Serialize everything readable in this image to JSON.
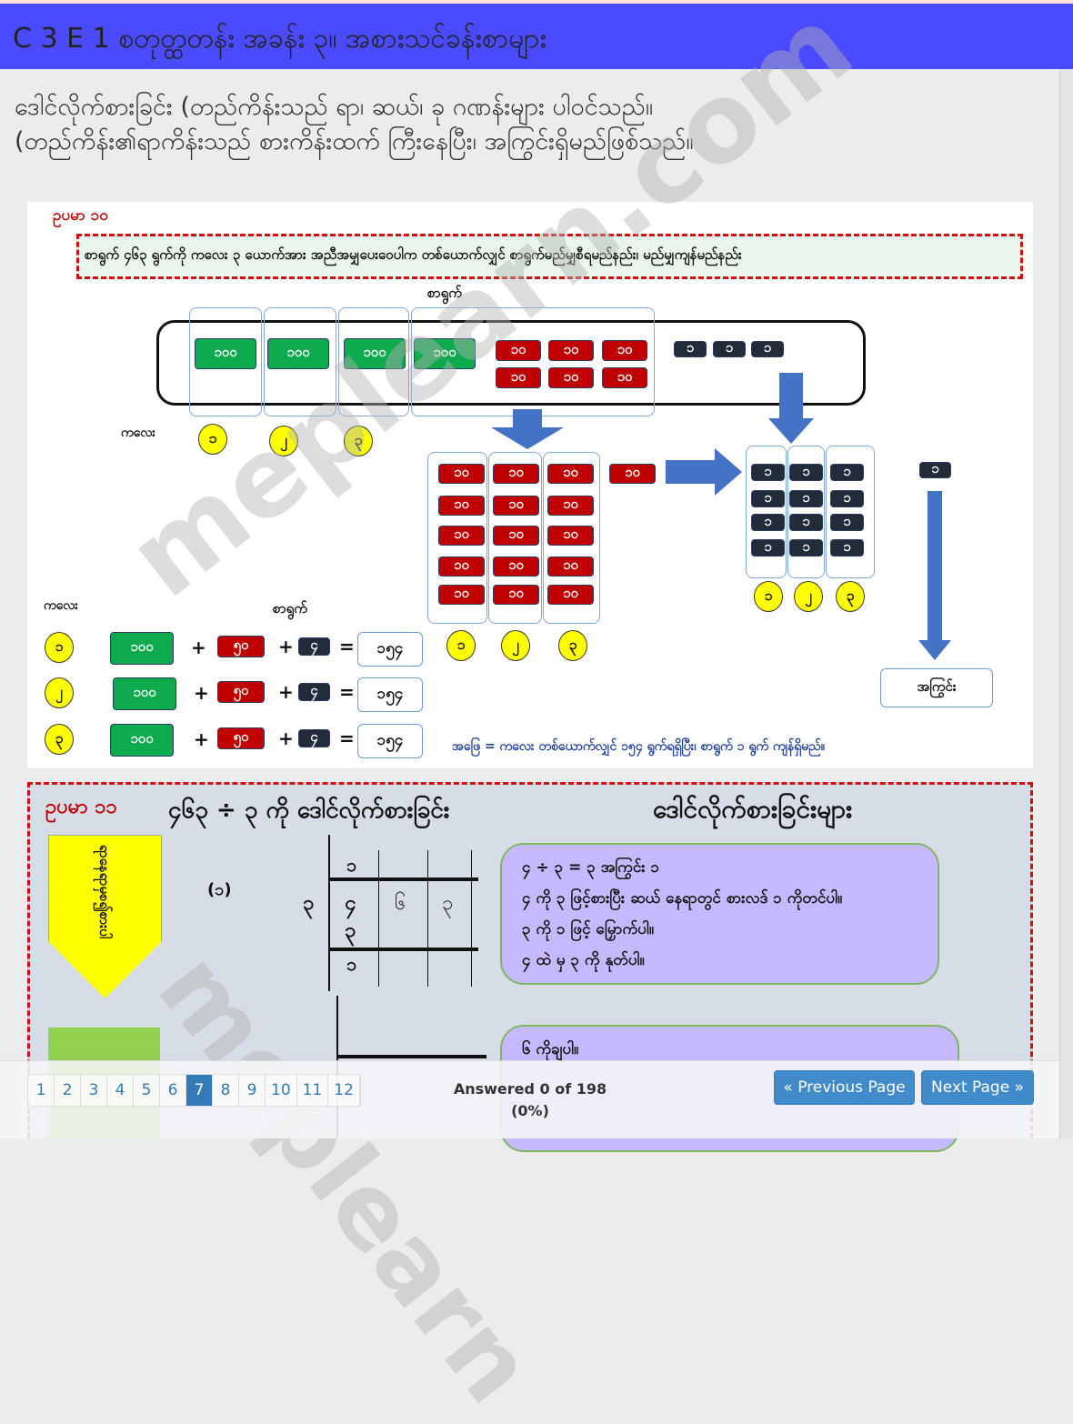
{
  "header": {
    "title": "C 3 E 1 စတုတ္ထတန်း အခန်း ၃။ အစားသင်ခန်းစာများ",
    "bg_color": "#4a4aff"
  },
  "intro": {
    "line1": "ဒေါင်လိုက်စားခြင်း (တည်ကိန်းသည် ရာ၊ ဆယ်၊ ခု ဂဏန်းများ ပါဝင်သည်။",
    "line2": "(တည်ကိန်း၏ရာကိန်းသည် စားကိန်းထက် ကြီးနေပြီး၊ အကြွင်းရှိမည်ဖြစ်သည်။"
  },
  "example10": {
    "label": "ဥပမာ ၁၀",
    "problem": "စာရွက် ၄၆၃ ရွက်ကို ကလေး ၃ ယောက်အား အညီအမျှပေးဝေပါက တစ်ယောက်လျှင် စာရွက်မည်မျှစီရမည်နည်း၊ မည်မျှကျန်မည်နည်း",
    "paper_label": "စာရွက်",
    "children_label": "ကလေး",
    "hundred": "၁၀၀",
    "ten": "၁၀",
    "one": "၁",
    "circles": [
      "၁",
      "၂",
      "၃"
    ],
    "rows": [
      {
        "child": "၁",
        "h": "၁၀၀",
        "t": "၅၀",
        "o": "၄",
        "sum": "၁၅၄"
      },
      {
        "child": "၂",
        "h": "၁၀၀",
        "t": "၅၀",
        "o": "၄",
        "sum": "၁၅၄"
      },
      {
        "child": "၃",
        "h": "၁၀၀",
        "t": "၅၀",
        "o": "၄",
        "sum": "၁၅၄"
      }
    ],
    "plus": "+",
    "equals": "=",
    "remainder_label": "အကြွင်း",
    "answer": "အဖြေ = ကလေး တစ်ယောက်လျှင် ၁၅၄ ရွက်ရရှိပြီး၊ စာရွက် ၁ ရွက် ကျန်ရှိမည်။"
  },
  "example11": {
    "label": "ဥပမာ ၁၁",
    "title": "၄၆၃ ÷ ၃ ကို ဒေါင်လိုက်စားခြင်း",
    "steps_title": "ဒေါင်လိုက်စားခြင်းများ",
    "arrow_text": "ရာနေရာမှစ၍စားပါ",
    "step_no": "(၁)",
    "divisor": "၃",
    "quotient": "၁",
    "dividend": [
      "၄",
      "၆",
      "၃"
    ],
    "sub": "၃",
    "rem": "၁",
    "step1": [
      "၄ ÷ ၃ = ၃ အကြွင်း ၁",
      "၄ ကို ၃ ဖြင့်စားပြီး ဆယ် နေရာတွင် စားလဒ် ၁ ကိုတင်ပါ။",
      "၃ ကို ၁ ဖြင့် မြှောက်ပါ။",
      "၄ ထဲ မှ ၃ ကို နုတ်ပါ။"
    ],
    "step2_first": "၆ ကိုချပါ။"
  },
  "watermark": "meplearn.com",
  "footer": {
    "pages": [
      "1",
      "2",
      "3",
      "4",
      "5",
      "6",
      "7",
      "8",
      "9",
      "10",
      "11",
      "12"
    ],
    "active_page": "7",
    "answered": "Answered 0 of 198",
    "percent": "(0%)",
    "prev": "« Previous Page",
    "next": "Next Page »",
    "accent": "#337ab7"
  }
}
